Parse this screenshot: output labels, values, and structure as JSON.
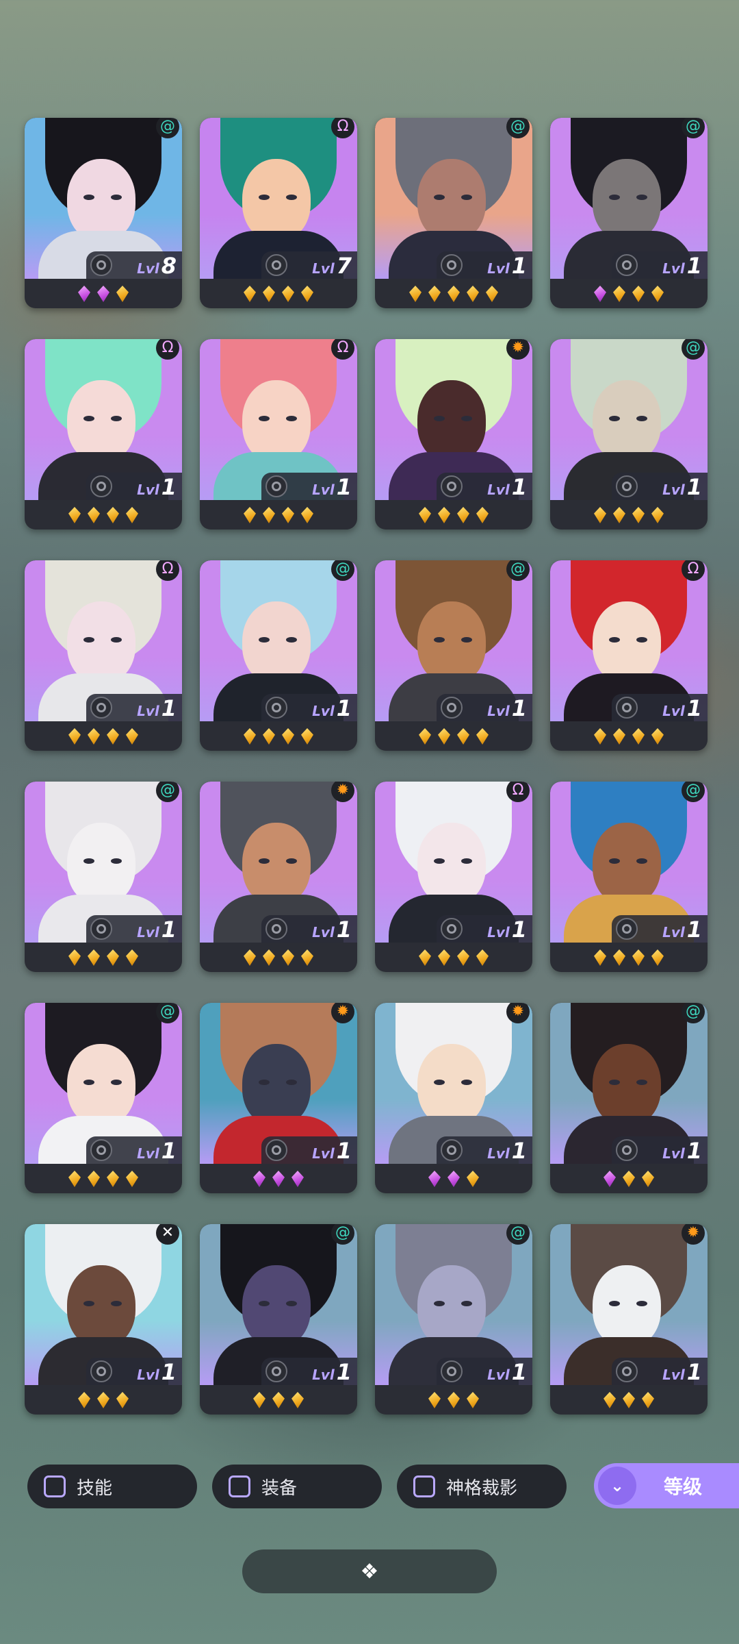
{
  "heroes": [
    {
      "faction": "swirl",
      "faction_color": "#3fd9c0",
      "level": "8",
      "stars": [
        "purple",
        "purple",
        "gold"
      ],
      "bg": "#6fb6e6",
      "hair": "#17161c",
      "skin": "#f0d8e2",
      "body": "#d8dbe6"
    },
    {
      "faction": "omega",
      "faction_color": "#f2a9ff",
      "level": "7",
      "stars": [
        "gold",
        "gold",
        "gold",
        "gold"
      ],
      "bg": "#c684ef",
      "hair": "#1e8f80",
      "skin": "#f4c7a7",
      "body": "#1d2232"
    },
    {
      "faction": "swirl",
      "faction_color": "#3fd9c0",
      "level": "1",
      "stars": [
        "gold",
        "gold",
        "gold",
        "gold",
        "gold"
      ],
      "bg": "#e9a58a",
      "hair": "#6d6f7a",
      "skin": "#ad7c6f",
      "body": "#2b2c3d"
    },
    {
      "faction": "swirl",
      "faction_color": "#3fd9c0",
      "level": "1",
      "stars": [
        "purple",
        "gold",
        "gold",
        "gold"
      ],
      "bg": "#c98aef",
      "hair": "#1b1a22",
      "skin": "#7b7677",
      "body": "#2a2b35"
    },
    {
      "faction": "omega",
      "faction_color": "#f2a9ff",
      "level": "1",
      "stars": [
        "gold",
        "gold",
        "gold",
        "gold"
      ],
      "bg": "#c98aef",
      "hair": "#7fe3c7",
      "skin": "#f5dad7",
      "body": "#2a2a33"
    },
    {
      "faction": "omega",
      "faction_color": "#f2a9ff",
      "level": "1",
      "stars": [
        "gold",
        "gold",
        "gold",
        "gold"
      ],
      "bg": "#c98aef",
      "hair": "#ee7f8c",
      "skin": "#f7d3c5",
      "body": "#6fc3c5"
    },
    {
      "faction": "sun",
      "faction_color": "#ff9a1a",
      "level": "1",
      "stars": [
        "gold",
        "gold",
        "gold",
        "gold"
      ],
      "bg": "#c98aef",
      "hair": "#d8f0c0",
      "skin": "#4a2b2c",
      "body": "#3e2a55"
    },
    {
      "faction": "swirl",
      "faction_color": "#3fd9c0",
      "level": "1",
      "stars": [
        "gold",
        "gold",
        "gold",
        "gold"
      ],
      "bg": "#c98aef",
      "hair": "#c9d8c8",
      "skin": "#d9cdbd",
      "body": "#2a2b30"
    },
    {
      "faction": "omega",
      "faction_color": "#f2a9ff",
      "level": "1",
      "stars": [
        "gold",
        "gold",
        "gold",
        "gold"
      ],
      "bg": "#c98aef",
      "hair": "#e4e3da",
      "skin": "#f2dfe6",
      "body": "#e7e7ea"
    },
    {
      "faction": "swirl",
      "faction_color": "#3fd9c0",
      "level": "1",
      "stars": [
        "gold",
        "gold",
        "gold",
        "gold"
      ],
      "bg": "#c98aef",
      "hair": "#a6d6ea",
      "skin": "#f2d5cf",
      "body": "#1f232c"
    },
    {
      "faction": "swirl",
      "faction_color": "#3fd9c0",
      "level": "1",
      "stars": [
        "gold",
        "gold",
        "gold",
        "gold"
      ],
      "bg": "#c98aef",
      "hair": "#7d5536",
      "skin": "#b87e55",
      "body": "#3d3d44"
    },
    {
      "faction": "omega",
      "faction_color": "#f2a9ff",
      "level": "1",
      "stars": [
        "gold",
        "gold",
        "gold",
        "gold"
      ],
      "bg": "#c98aef",
      "hair": "#d2262c",
      "skin": "#f4dccd",
      "body": "#1e1a22"
    },
    {
      "faction": "swirl",
      "faction_color": "#3fd9c0",
      "level": "1",
      "stars": [
        "gold",
        "gold",
        "gold",
        "gold"
      ],
      "bg": "#c98aef",
      "hair": "#e8e6ea",
      "skin": "#f2f0f2",
      "body": "#e9e8ec"
    },
    {
      "faction": "sun",
      "faction_color": "#ff9a1a",
      "level": "1",
      "stars": [
        "gold",
        "gold",
        "gold",
        "gold"
      ],
      "bg": "#c98aef",
      "hair": "#50535c",
      "skin": "#c88d6b",
      "body": "#3d3f46"
    },
    {
      "faction": "omega",
      "faction_color": "#f2a9ff",
      "level": "1",
      "stars": [
        "gold",
        "gold",
        "gold",
        "gold"
      ],
      "bg": "#c98aef",
      "hair": "#eef0f4",
      "skin": "#f3e6ea",
      "body": "#242730"
    },
    {
      "faction": "swirl",
      "faction_color": "#3fd9c0",
      "level": "1",
      "stars": [
        "gold",
        "gold",
        "gold",
        "gold"
      ],
      "bg": "#c98aef",
      "hair": "#2e7fc2",
      "skin": "#9c6446",
      "body": "#d9a34b"
    },
    {
      "faction": "swirl",
      "faction_color": "#3fd9c0",
      "level": "1",
      "stars": [
        "gold",
        "gold",
        "gold",
        "gold"
      ],
      "bg": "#c98aef",
      "hair": "#1d1b22",
      "skin": "#f5dcd2",
      "body": "#f2f2f4"
    },
    {
      "faction": "sun",
      "faction_color": "#ff9a1a",
      "level": "1",
      "stars": [
        "purple",
        "purple",
        "purple"
      ],
      "bg": "#4fa0bd",
      "hair": "#b57b5a",
      "skin": "#3a3e52",
      "body": "#c3272e"
    },
    {
      "faction": "sun",
      "faction_color": "#ff9a1a",
      "level": "1",
      "stars": [
        "purple",
        "purple",
        "gold"
      ],
      "bg": "#7fb4cf",
      "hair": "#f0f0f2",
      "skin": "#f4dcc8",
      "body": "#6f7480"
    },
    {
      "faction": "swirl",
      "faction_color": "#3fd9c0",
      "level": "1",
      "stars": [
        "purple",
        "gold",
        "gold"
      ],
      "bg": "#7fa7bf",
      "hair": "#241d20",
      "skin": "#6c3f2c",
      "body": "#2b2630"
    },
    {
      "faction": "cross",
      "faction_color": "#ffffff",
      "level": "1",
      "stars": [
        "gold",
        "gold",
        "gold"
      ],
      "bg": "#8fd6e2",
      "hair": "#eceff2",
      "skin": "#6c4a3c",
      "body": "#2c2b31"
    },
    {
      "faction": "swirl",
      "faction_color": "#3fd9c0",
      "level": "1",
      "stars": [
        "gold",
        "gold",
        "gold"
      ],
      "bg": "#7fa7bf",
      "hair": "#16161c",
      "skin": "#514873",
      "body": "#1f1f27"
    },
    {
      "faction": "swirl",
      "faction_color": "#3fd9c0",
      "level": "1",
      "stars": [
        "gold",
        "gold",
        "gold"
      ],
      "bg": "#7fa7bf",
      "hair": "#7d7f93",
      "skin": "#a7a7c7",
      "body": "#2e2f3b"
    },
    {
      "faction": "sun",
      "faction_color": "#ff9a1a",
      "level": "1",
      "stars": [
        "gold",
        "gold",
        "gold"
      ],
      "bg": "#7fa7bf",
      "hair": "#5b4b45",
      "skin": "#eef0f2",
      "body": "#3b2e2a"
    }
  ],
  "level_label": "Lvl",
  "faction_glyphs": {
    "swirl": "@",
    "omega": "Ω",
    "sun": "✹",
    "cross": "✕"
  },
  "filters": {
    "skill_label": "技能",
    "equipment_label": "装备",
    "divine_label": "神格裁影"
  },
  "sort": {
    "label": "等级",
    "icon": "chevrons-down-icon"
  },
  "bottom_handle": {
    "icon": "collapse-handle-icon"
  }
}
